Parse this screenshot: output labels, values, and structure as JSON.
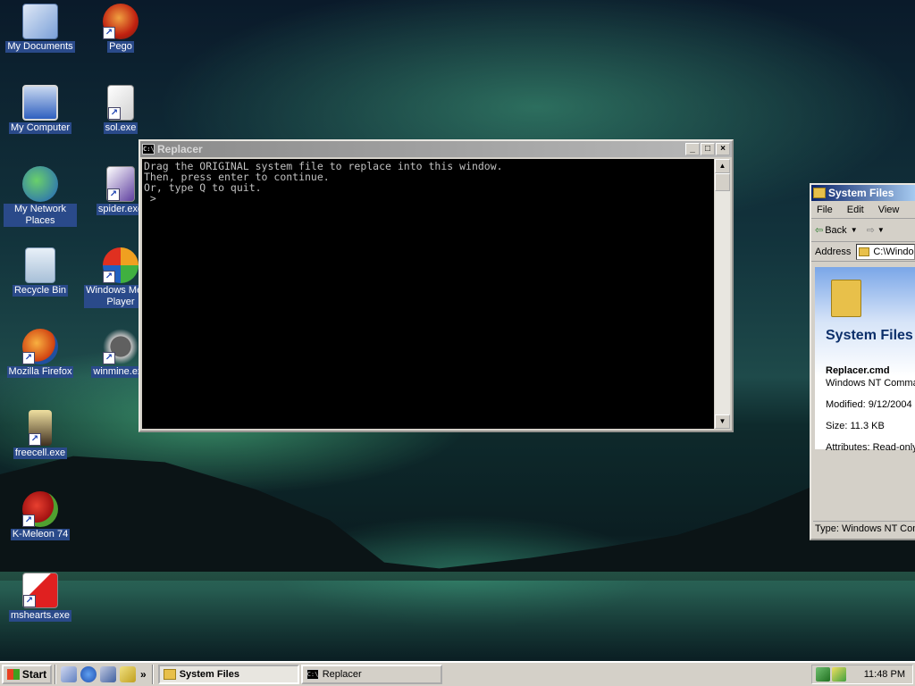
{
  "desktop": {
    "icons": [
      {
        "label": "My Documents"
      },
      {
        "label": "Pego"
      },
      {
        "label": "My Computer"
      },
      {
        "label": "sol.exe"
      },
      {
        "label": "My Network Places"
      },
      {
        "label": "spider.exe"
      },
      {
        "label": "Recycle Bin"
      },
      {
        "label": "Windows Media Player"
      },
      {
        "label": "Mozilla Firefox"
      },
      {
        "label": "winmine.exe"
      },
      {
        "label": "freecell.exe"
      },
      {
        "label": "K-Meleon 74"
      },
      {
        "label": "mshearts.exe"
      }
    ]
  },
  "replacer": {
    "title": "Replacer",
    "lines": [
      "Drag the ORIGINAL system file to replace into this window.",
      "Then, press enter to continue.",
      "Or, type Q to quit.",
      "",
      " >"
    ]
  },
  "explorer": {
    "title": "System Files",
    "menu": {
      "file": "File",
      "edit": "Edit",
      "view": "View"
    },
    "toolbar": {
      "back": "Back"
    },
    "address_label": "Address",
    "address_value": "C:\\Windo",
    "folder_title": "System Files",
    "file_name": "Replacer.cmd",
    "file_type": "Windows NT Comman",
    "modified": "Modified: 9/12/2004",
    "size": "Size: 11.3 KB",
    "attributes": "Attributes: Read-only",
    "status": "Type: Windows NT Com"
  },
  "taskbar": {
    "start_label": "Start",
    "tasks": [
      {
        "label": "System Files",
        "active": true
      },
      {
        "label": "Replacer",
        "active": false
      }
    ],
    "clock": "11:48 PM"
  }
}
